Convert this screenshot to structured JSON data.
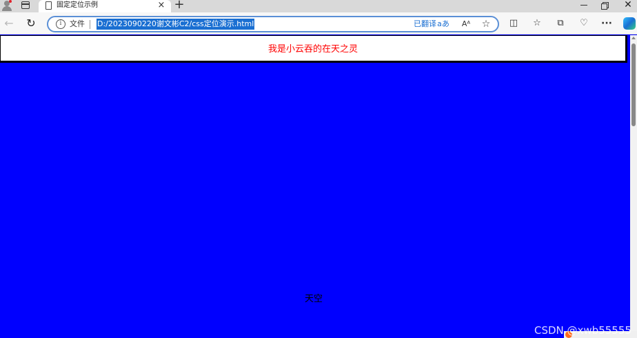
{
  "browser": {
    "tab": {
      "title": "固定定位示例",
      "close_icon": "×"
    },
    "new_tab_icon": "+",
    "window_controls": {
      "close_icon": "✕"
    },
    "address_bar": {
      "site_info_label": "文件",
      "url": "D:/2023090220谢文彬C2/css定位演示.html",
      "translated_label": "已翻译",
      "translate_icon_text": "aあ",
      "read_aloud_icon_text": "Aᴬ",
      "favorite_icon": "☆"
    },
    "toolbar_icons": {
      "back": "←",
      "reload": "↻",
      "split_screen": "◫",
      "favorites": "☆",
      "collections": "⧉",
      "performance": "♡",
      "more": "···"
    }
  },
  "page": {
    "background_color": "#0000ff",
    "fixed_header": {
      "text": "我是小云吞的在天之灵",
      "text_color": "#ff0000",
      "background_color": "#ffffff"
    },
    "body_text": "天空"
  },
  "overlay": {
    "watermark": "CSDN @xwb55555"
  }
}
